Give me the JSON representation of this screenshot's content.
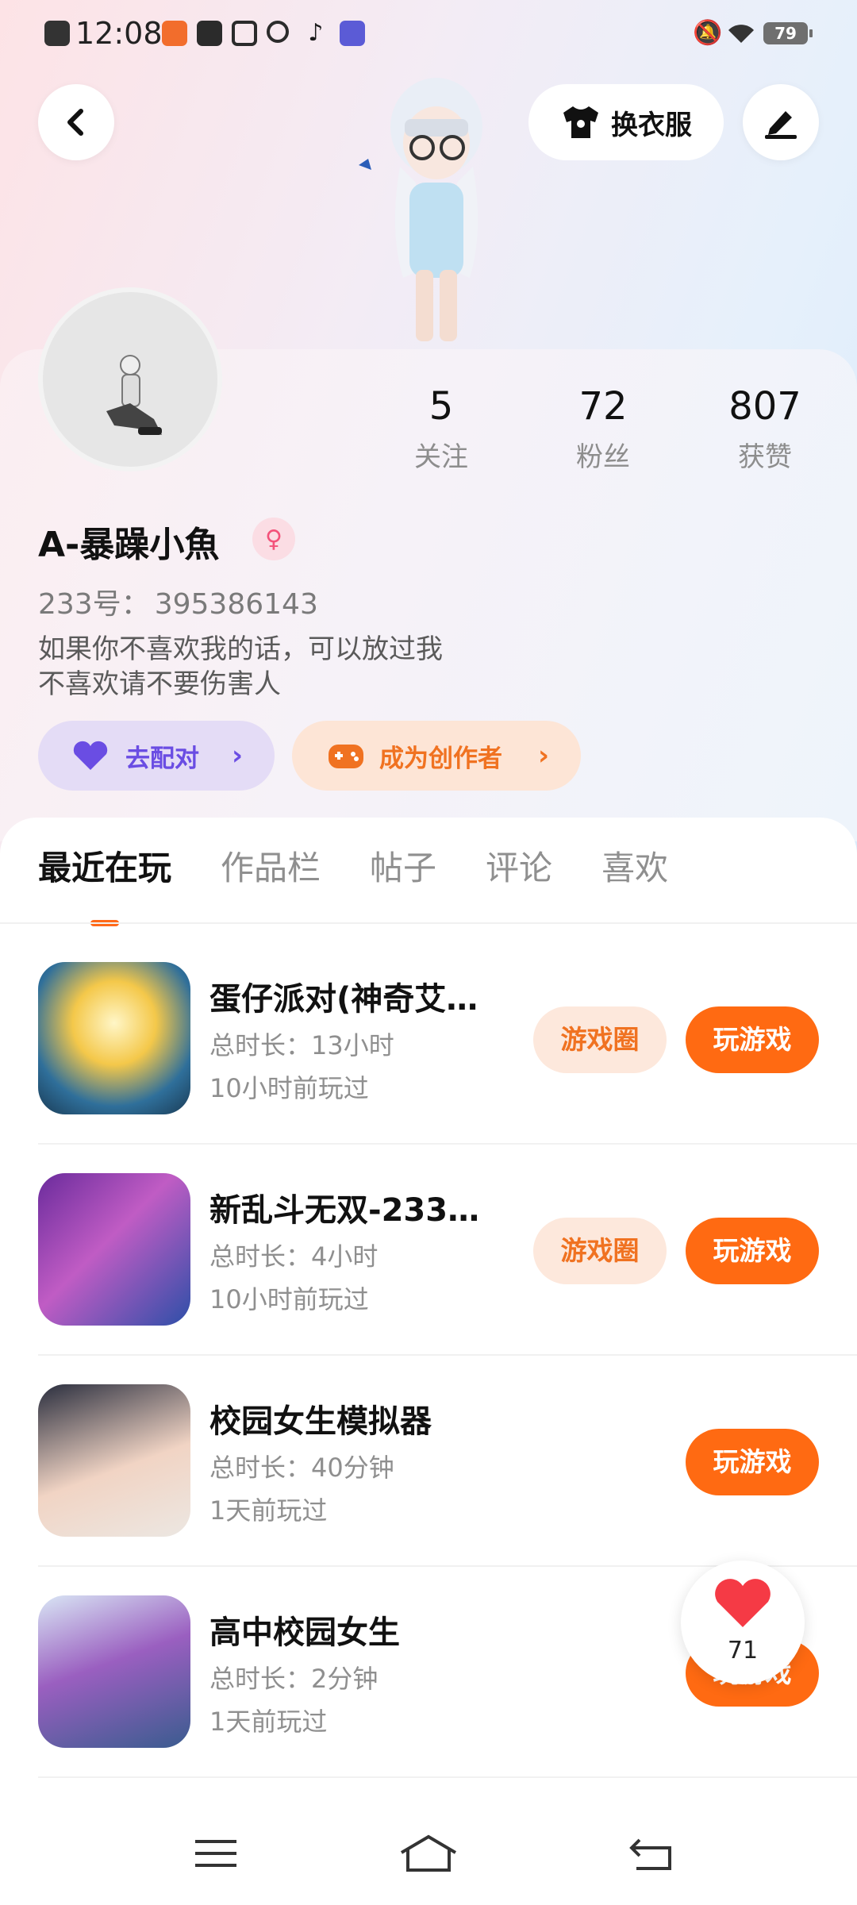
{
  "status_bar": {
    "time": "12:08",
    "battery": "79",
    "icons": [
      "close-notification-icon",
      "app-icon",
      "square-icon",
      "card-icon",
      "search-icon",
      "tiktok-icon",
      "app-badge-icon",
      "mute-icon",
      "wifi-icon"
    ]
  },
  "header": {
    "dress_label": "换衣服",
    "icons": [
      "back-icon",
      "tshirt-icon",
      "edit-icon"
    ]
  },
  "profile": {
    "stats": [
      {
        "num": "5",
        "label": "关注"
      },
      {
        "num": "72",
        "label": "粉丝"
      },
      {
        "num": "807",
        "label": "获赞"
      }
    ],
    "name": "A-暴躁小魚",
    "uid_label": "233号：",
    "uid_value": "395386143",
    "bio_line1": "如果你不喜欢我的话，可以放过我",
    "bio_line2": "不喜欢请不要伤害人",
    "match_label": "去配对",
    "creator_label": "成为创作者"
  },
  "tabs": [
    {
      "label": "最近在玩",
      "active": true
    },
    {
      "label": "作品栏"
    },
    {
      "label": "帖子"
    },
    {
      "label": "评论"
    },
    {
      "label": "喜欢"
    }
  ],
  "games": [
    {
      "title": "蛋仔派对(神奇艾…",
      "duration": "总时长：13小时",
      "last": "10小时前玩过",
      "circle": "游戏圈",
      "play": "玩游戏"
    },
    {
      "title": "新乱斗无双-233…",
      "duration": "总时长：4小时",
      "last": "10小时前玩过",
      "circle": "游戏圈",
      "play": "玩游戏"
    },
    {
      "title": "校园女生模拟器",
      "duration": "总时长：40分钟",
      "last": "1天前玩过",
      "play": "玩游戏"
    },
    {
      "title": "高中校园女生",
      "duration": "总时长：2分钟",
      "last": "1天前玩过",
      "play": "玩游戏"
    }
  ],
  "like_float": {
    "count": "71"
  },
  "colors": {
    "accent": "#ff6a12",
    "accent_light": "#fde8dc",
    "purple": "#6a4de3"
  }
}
